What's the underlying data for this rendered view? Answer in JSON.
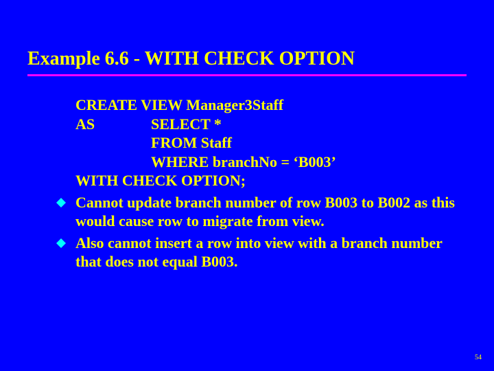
{
  "title": "Example 6.6 - WITH CHECK OPTION",
  "code": {
    "l1": "CREATE VIEW Manager3Staff",
    "l2a": "AS",
    "l2b": "SELECT *",
    "l3": "FROM Staff",
    "l4": "WHERE branchNo = ‘B003’",
    "l5": "WITH CHECK OPTION;"
  },
  "bullets": [
    "Cannot update branch number of row B003 to B002 as this would cause row to migrate from view.",
    "Also cannot insert a row into view with a branch number that does not equal B003."
  ],
  "page": "54"
}
